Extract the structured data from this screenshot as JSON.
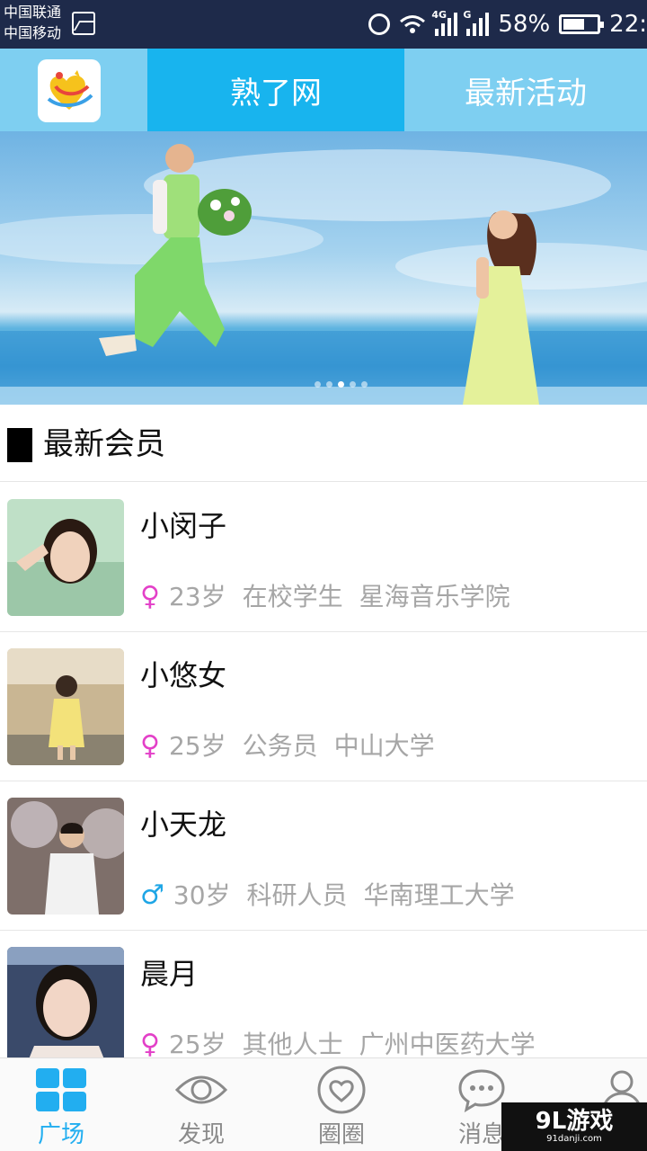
{
  "status_bar": {
    "carrier_1": "中国联通",
    "carrier_2": "中国移动",
    "signal_1_label": "4G",
    "signal_2_label": "G",
    "battery": "58%",
    "time": "22:"
  },
  "header": {
    "active_tab": "熟了网",
    "right_tab": "最新活动"
  },
  "banner": {
    "slides_total": 5,
    "active_slide": 3
  },
  "section": {
    "title": "最新会员"
  },
  "members": [
    {
      "name": "小闵子",
      "gender_symbol": "♀",
      "gender": "female",
      "age": "23岁",
      "occupation": "在校学生",
      "school": "星海音乐学院"
    },
    {
      "name": "小悠女",
      "gender_symbol": "♀",
      "gender": "female",
      "age": "25岁",
      "occupation": "公务员",
      "school": "中山大学"
    },
    {
      "name": "小天龙",
      "gender_symbol": "♂",
      "gender": "male",
      "age": "30岁",
      "occupation": "科研人员",
      "school": "华南理工大学"
    },
    {
      "name": "晨月",
      "gender_symbol": "♀",
      "gender": "female",
      "age": "25岁",
      "occupation": "其他人士",
      "school": "广州中医药大学"
    }
  ],
  "bottom_nav": {
    "items": [
      {
        "label": "广场",
        "icon": "grid-icon",
        "active": true
      },
      {
        "label": "发现",
        "icon": "eye-icon",
        "active": false
      },
      {
        "label": "圈圈",
        "icon": "heart-circle-icon",
        "active": false
      },
      {
        "label": "消息",
        "icon": "chat-bubble-icon",
        "active": false
      },
      {
        "label": "",
        "icon": "user-icon",
        "active": false
      }
    ]
  },
  "watermark": {
    "main": "9L游戏",
    "sub": "91danji.com"
  },
  "colors": {
    "header_bg": "#7ecff1",
    "active_tab_bg": "#18b4ee",
    "female": "#e340c8",
    "male": "#1ea6e6",
    "nav_active": "#22aef0"
  }
}
